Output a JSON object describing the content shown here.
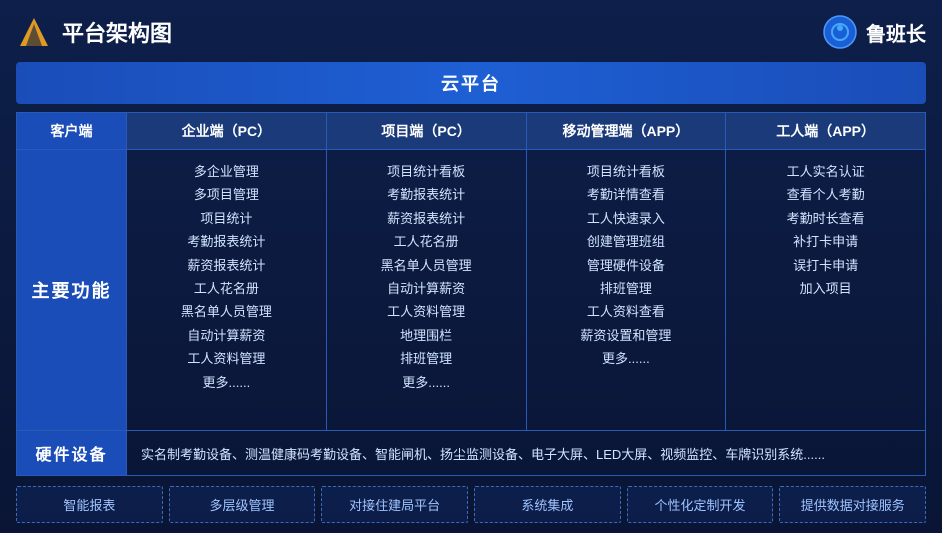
{
  "header": {
    "title": "平台架构图",
    "brand": "鲁班长"
  },
  "cloud_platform": "云平台",
  "columns": {
    "client": "客户端",
    "enterprise": "企业端（PC）",
    "project": "项目端（PC）",
    "mobile": "移动管理端（APP）",
    "worker": "工人端（APP）"
  },
  "main_function_label": "主要功能",
  "enterprise_items": [
    "多企业管理",
    "多项目管理",
    "项目统计",
    "考勤报表统计",
    "薪资报表统计",
    "工人花名册",
    "黑名单人员管理",
    "自动计算薪资",
    "工人资料管理",
    "更多......"
  ],
  "project_items": [
    "项目统计看板",
    "考勤报表统计",
    "薪资报表统计",
    "工人花名册",
    "黑名单人员管理",
    "自动计算薪资",
    "工人资料管理",
    "地理围栏",
    "排班管理",
    "更多......"
  ],
  "mobile_items": [
    "项目统计看板",
    "考勤详情查看",
    "工人快速录入",
    "创建管理班组",
    "管理硬件设备",
    "排班管理",
    "工人资料查看",
    "薪资设置和管理",
    "更多......"
  ],
  "worker_items": [
    "工人实名认证",
    "查看个人考勤",
    "考勤时长查看",
    "补打卡申请",
    "误打卡申请",
    "加入项目"
  ],
  "hardware": {
    "label": "硬件设备",
    "content": "实名制考勤设备、测温健康码考勤设备、智能闸机、扬尘监测设备、电子大屏、LED大屏、视频监控、车牌识别系统......"
  },
  "features": [
    "智能报表",
    "多层级管理",
    "对接住建局平台",
    "系统集成",
    "个性化定制开发",
    "提供数据对接服务"
  ]
}
